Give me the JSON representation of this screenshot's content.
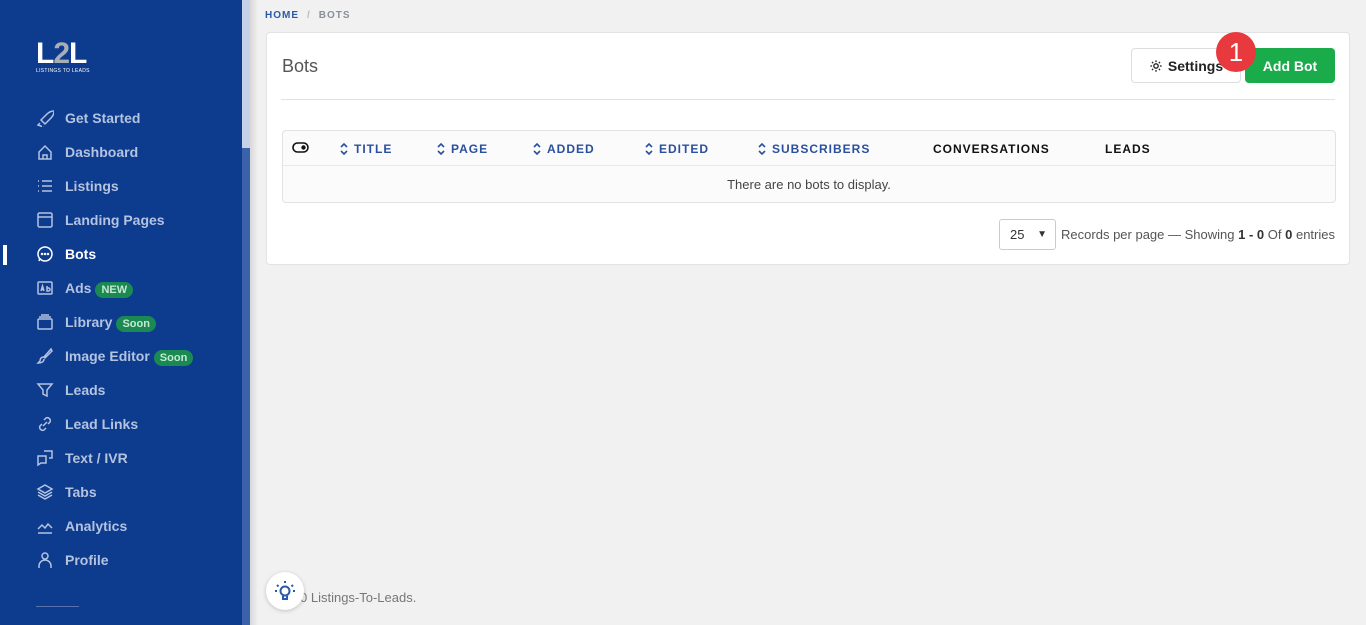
{
  "logo": {
    "text_main": "L",
    "text_2": "2",
    "text_end": "L",
    "tagline": "LISTINGS TO LEADS"
  },
  "sidebar": {
    "items": [
      {
        "label": "Get Started",
        "icon": "rocket-icon"
      },
      {
        "label": "Dashboard",
        "icon": "home-icon"
      },
      {
        "label": "Listings",
        "icon": "list-icon"
      },
      {
        "label": "Landing Pages",
        "icon": "window-icon"
      },
      {
        "label": "Bots",
        "icon": "chat-icon",
        "active": true
      },
      {
        "label": "Ads",
        "icon": "ad-icon",
        "badge": "NEW"
      },
      {
        "label": "Library",
        "icon": "collection-icon",
        "badge": "Soon"
      },
      {
        "label": "Image Editor",
        "icon": "brush-icon",
        "badge": "Soon"
      },
      {
        "label": "Leads",
        "icon": "funnel-icon"
      },
      {
        "label": "Lead Links",
        "icon": "link-icon"
      },
      {
        "label": "Text / IVR",
        "icon": "chat-squares-icon"
      },
      {
        "label": "Tabs",
        "icon": "layers-icon"
      },
      {
        "label": "Analytics",
        "icon": "chart-icon"
      },
      {
        "label": "Profile",
        "icon": "person-icon"
      }
    ]
  },
  "breadcrumb": {
    "home": "HOME",
    "sep": "/",
    "current": "BOTS"
  },
  "card": {
    "title": "Bots",
    "settings_label": "Settings",
    "add_label": "Add Bot",
    "marker": "1"
  },
  "table": {
    "columns": [
      "TITLE",
      "PAGE",
      "ADDED",
      "EDITED",
      "SUBSCRIBERS",
      "CONVERSATIONS",
      "LEADS"
    ],
    "empty": "There are no bots to display."
  },
  "pager": {
    "per_page": "25",
    "text1": "Records per page — Showing",
    "range": "1 - 0",
    "text2": "Of",
    "total": "0",
    "text3": "entries"
  },
  "footer": {
    "text": "0 Listings-To-Leads."
  },
  "colors": {
    "sidebar": "#0d3b8e",
    "primary": "#1aab4b",
    "badge": "#1a8a52",
    "marker": "#e8393f"
  }
}
